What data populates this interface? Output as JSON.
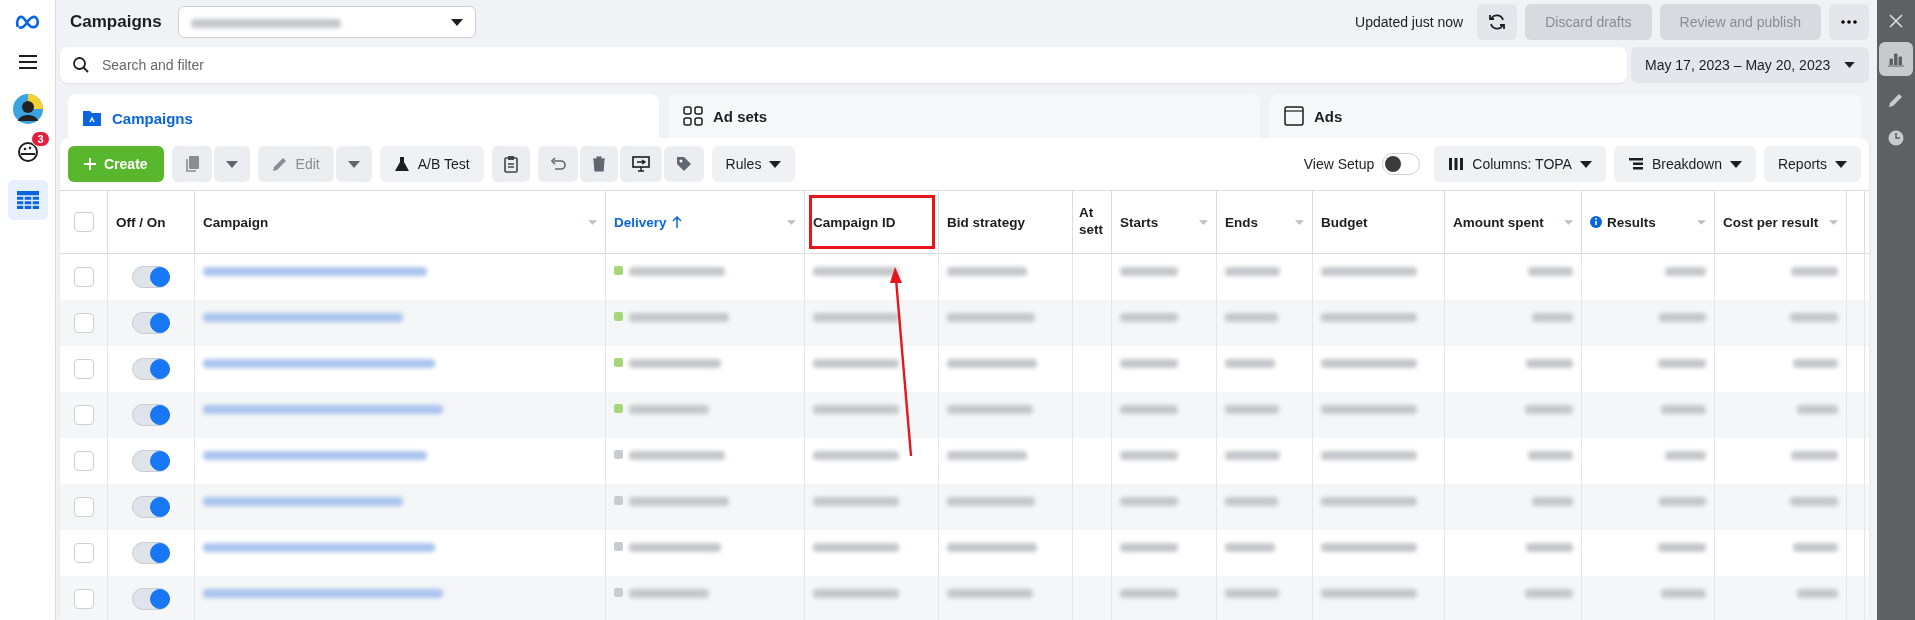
{
  "header": {
    "title": "Campaigns",
    "updated": "Updated just now",
    "buttons": [
      {
        "label": "Discard drafts",
        "disabled": true
      },
      {
        "label": "Review and publish",
        "disabled": true
      }
    ]
  },
  "left_nav": {
    "badge": "3"
  },
  "search": {
    "placeholder": "Search and filter"
  },
  "date_range": "May 17, 2023 – May 20, 2023",
  "tabs": [
    {
      "label": "Campaigns",
      "selected": true
    },
    {
      "label": "Ad sets",
      "selected": false
    },
    {
      "label": "Ads",
      "selected": false
    }
  ],
  "toolbar": {
    "create": "Create",
    "edit": {
      "label": "Edit",
      "disabled": true
    },
    "ab_test": "A/B Test",
    "rules": "Rules",
    "view_setup": {
      "label": "View Setup",
      "on": false
    },
    "columns": "Columns: TOPA",
    "breakdown": "Breakdown",
    "reports": "Reports"
  },
  "table": {
    "all_checked": false,
    "columns": [
      {
        "label": "Off / On",
        "sorted": false,
        "menu": false,
        "info": false,
        "highlighted": false
      },
      {
        "label": "Campaign",
        "sorted": false,
        "menu": true,
        "info": false,
        "highlighted": false
      },
      {
        "label": "Delivery",
        "sorted": true,
        "menu": true,
        "info": false,
        "highlighted": false
      },
      {
        "label": "Campaign ID",
        "sorted": false,
        "menu": false,
        "info": false,
        "highlighted": true
      },
      {
        "label": "Bid strategy",
        "sorted": false,
        "menu": false,
        "info": false,
        "highlighted": false
      },
      {
        "label": "At sett",
        "sorted": false,
        "highlighted": false
      },
      {
        "label": "Starts",
        "sorted": false,
        "menu": true,
        "info": false,
        "highlighted": false
      },
      {
        "label": "Ends",
        "sorted": false,
        "menu": true,
        "info": false,
        "highlighted": false
      },
      {
        "label": "Budget",
        "sorted": false,
        "menu": false,
        "info": false,
        "highlighted": false
      },
      {
        "label": "Amount spent",
        "sorted": false,
        "menu": true,
        "info": false,
        "highlighted": false
      },
      {
        "label": "Results",
        "sorted": false,
        "menu": true,
        "info": true,
        "highlighted": false
      },
      {
        "label": "Cost per result",
        "sorted": false,
        "menu": true,
        "info": false,
        "highlighted": false
      }
    ],
    "rows": [
      {
        "checked": false,
        "on": true,
        "color": "#a5d67a"
      },
      {
        "checked": false,
        "on": true,
        "color": "#a5d67a"
      },
      {
        "checked": false,
        "on": true,
        "color": "#a5d67a"
      },
      {
        "checked": false,
        "on": true,
        "color": "#a5d67a"
      },
      {
        "checked": false,
        "on": true,
        "color": "#c8cbd0"
      },
      {
        "checked": false,
        "on": true,
        "color": "#c8cbd0"
      },
      {
        "checked": false,
        "on": true,
        "color": "#c8cbd0"
      },
      {
        "checked": false,
        "on": true,
        "color": "#c8cbd0"
      }
    ]
  }
}
